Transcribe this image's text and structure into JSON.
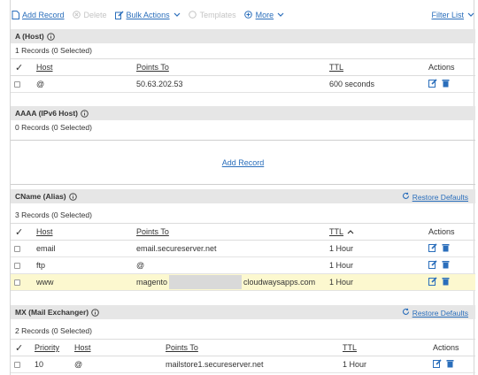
{
  "toolbar": {
    "add_record": "Add Record",
    "delete": "Delete",
    "bulk_actions": "Bulk Actions",
    "templates": "Templates",
    "more": "More",
    "filter_list": "Filter List"
  },
  "a_section": {
    "title": "A (Host)",
    "count": "1 Records (0 Selected)",
    "headers": {
      "host": "Host",
      "points_to": "Points To",
      "ttl": "TTL",
      "actions": "Actions"
    },
    "rows": [
      {
        "host": "@",
        "points_to": "50.63.202.53",
        "ttl": "600 seconds"
      }
    ]
  },
  "aaaa_section": {
    "title": "AAAA (IPv6 Host)",
    "count": "0 Records (0 Selected)",
    "add_record": "Add Record"
  },
  "cname_section": {
    "title": "CName (Alias)",
    "restore": "Restore Defaults",
    "count": "3 Records (0 Selected)",
    "headers": {
      "host": "Host",
      "points_to": "Points To",
      "ttl": "TTL",
      "actions": "Actions"
    },
    "rows": [
      {
        "host": "email",
        "points_to": "email.secureserver.net",
        "ttl": "1 Hour"
      },
      {
        "host": "ftp",
        "points_to": "@",
        "ttl": "1 Hour"
      },
      {
        "host": "www",
        "points_to_prefix": "magento",
        "points_to_suffix": "cloudwaysapps.com",
        "ttl": "1 Hour"
      }
    ]
  },
  "mx_section": {
    "title": "MX (Mail Exchanger)",
    "restore": "Restore Defaults",
    "count": "2 Records (0 Selected)",
    "headers": {
      "priority": "Priority",
      "host": "Host",
      "points_to": "Points To",
      "ttl": "TTL",
      "actions": "Actions"
    },
    "rows": [
      {
        "priority": "10",
        "host": "@",
        "points_to": "mailstore1.secureserver.net",
        "ttl": "1 Hour"
      }
    ]
  },
  "colors": {
    "link": "#2a6ebb",
    "section_bg": "#e6e6e6",
    "highlight": "#fcf8cf"
  }
}
